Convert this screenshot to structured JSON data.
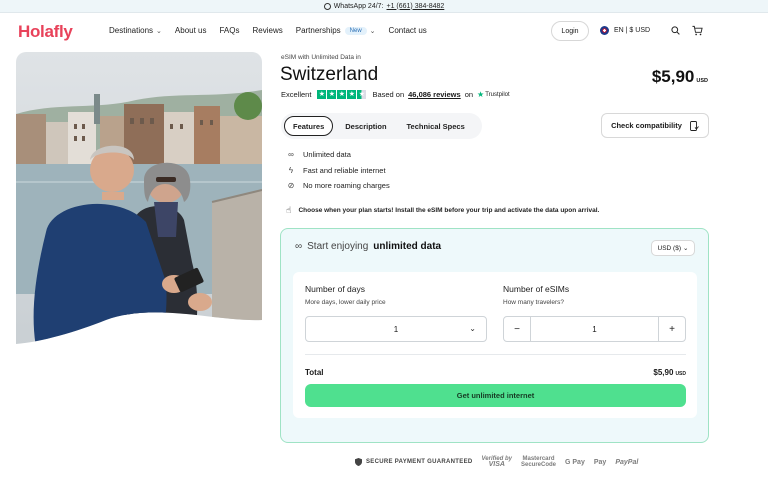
{
  "topbar": {
    "whatsapp_label": "WhatsApp 24/7:",
    "phone": "+1 (661) 384-8482"
  },
  "header": {
    "logo": "Holafly",
    "nav": [
      {
        "label": "Destinations",
        "has_chevron": true
      },
      {
        "label": "About us"
      },
      {
        "label": "FAQs"
      },
      {
        "label": "Reviews"
      },
      {
        "label": "Partnerships",
        "badge": "New",
        "has_chevron": true
      },
      {
        "label": "Contact us"
      }
    ],
    "login": "Login",
    "locale": "EN | $ USD",
    "icons": [
      "uk-flag-icon",
      "search-icon",
      "cart-icon"
    ]
  },
  "product": {
    "eyebrow": "eSIM with Unlimited Data in",
    "title": "Switzerland",
    "price": "$5,90",
    "currency": "USD",
    "rating_word": "Excellent",
    "rating_stars": 4.5,
    "based_on": "Based on",
    "reviews": "46,086 reviews",
    "on": "on",
    "trustpilot": "Trustpilot"
  },
  "tabs": [
    {
      "label": "Features",
      "active": true
    },
    {
      "label": "Description",
      "active": false
    },
    {
      "label": "Technical Specs",
      "active": false
    }
  ],
  "check_compat": "Check compatibility",
  "features": [
    {
      "icon": "infinity-icon",
      "label": "Unlimited data"
    },
    {
      "icon": "lightning-icon",
      "label": "Fast and reliable internet"
    },
    {
      "icon": "no-roaming-icon",
      "label": "No more roaming charges"
    }
  ],
  "note": "Choose when your plan starts! Install the eSIM before your trip and activate the data upon arrival.",
  "plan": {
    "heading_prefix": "Start enjoying",
    "heading_bold": "unlimited data",
    "currency_select": "USD ($)",
    "days_label": "Number of days",
    "days_help": "More days, lower daily price",
    "days_value": "1",
    "esims_label": "Number of eSIMs",
    "esims_help": "How many travelers?",
    "esims_value": "1",
    "minus": "−",
    "plus": "+",
    "total_label": "Total",
    "total_value": "$5,90",
    "total_currency": "USD",
    "cta": "Get unlimited internet"
  },
  "footer": {
    "secure": "SECURE PAYMENT GUARANTEED",
    "verified_by": "Verified by",
    "visa": "VISA",
    "mastercard": "Mastercard",
    "securecode": "SecureCode",
    "gpay": "G Pay",
    "applepay": " Pay",
    "paypal": "PayPal"
  },
  "colors": {
    "brand": "#e8425a",
    "cta": "#4fe08f",
    "plan_bg": "#eef9fb",
    "plan_border": "#9fe3c5",
    "trustpilot": "#00b67a"
  }
}
